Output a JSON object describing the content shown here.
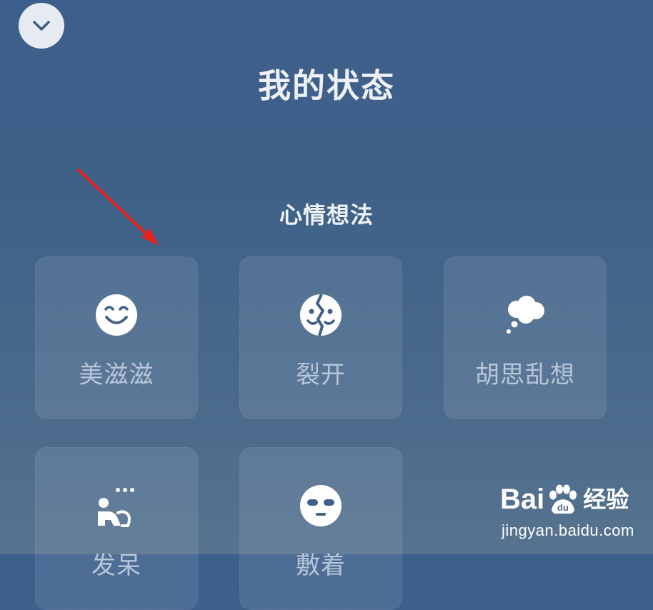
{
  "header": {
    "title": "我的状态",
    "collapse_icon": "chevron-down-icon"
  },
  "section": {
    "title": "心情想法"
  },
  "statuses": [
    {
      "label": "美滋滋",
      "icon": "smile-icon"
    },
    {
      "label": "裂开",
      "icon": "cracked-face-icon"
    },
    {
      "label": "胡思乱想",
      "icon": "thought-cloud-icon"
    },
    {
      "label": "发呆",
      "icon": "daze-person-icon"
    },
    {
      "label": "敷着",
      "icon": "face-mask-icon"
    }
  ],
  "annotation": {
    "arrow_color": "#e8211d"
  },
  "watermark": {
    "brand_left": "Bai",
    "brand_right": "经验",
    "url": "jingyan.baidu.com"
  },
  "colors": {
    "background": "#3f6188",
    "tile": "rgba(255,255,255,0.09)",
    "label": "#b7c6d8",
    "title": "#eef2f7"
  }
}
